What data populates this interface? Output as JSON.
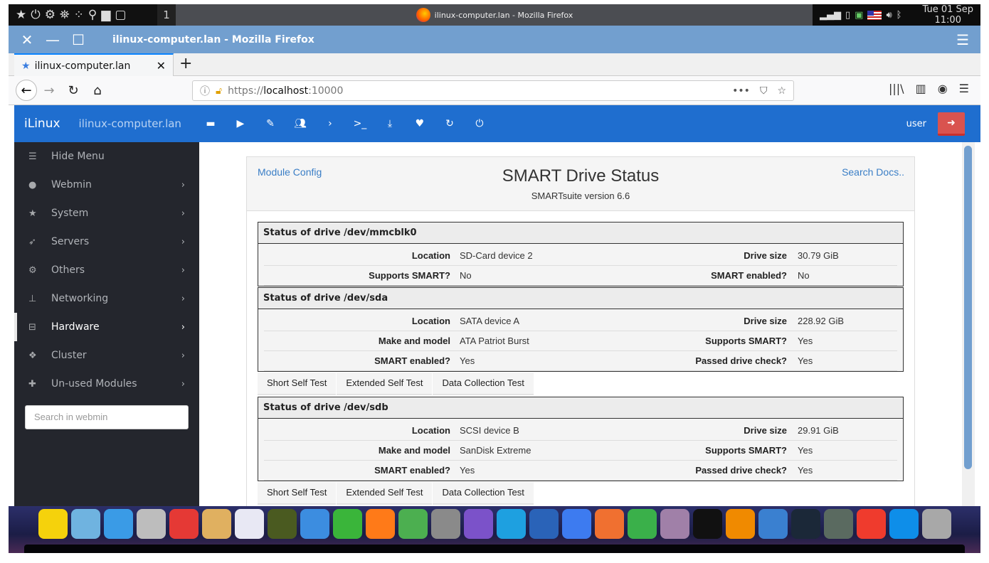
{
  "top_panel": {
    "workspace": "1",
    "window_title": "ilinux-computer.lan - Mozilla Firefox",
    "clock_day": "Tue 01 Sep",
    "clock_time": "11:00"
  },
  "window": {
    "title": "ilinux-computer.lan - Mozilla Firefox"
  },
  "browser": {
    "tab_title": "ilinux-computer.lan",
    "url_scheme": "https://",
    "url_host": "localhost",
    "url_port": ":10000"
  },
  "webmin_header": {
    "brand": "iLinux",
    "hostname": "ilinux-computer.lan",
    "user": "user",
    "icons": [
      "folder-icon",
      "play-icon",
      "pencil-icon",
      "users-icon",
      "chevron-right-icon",
      "terminal-icon",
      "download-icon",
      "heartbeat-icon",
      "refresh-icon",
      "power-icon"
    ]
  },
  "sidebar": {
    "items": [
      {
        "label": "Hide Menu",
        "icon": "bars-icon",
        "chevron": false
      },
      {
        "label": "Webmin",
        "icon": "globe-icon",
        "chevron": true
      },
      {
        "label": "System",
        "icon": "star-icon",
        "chevron": true
      },
      {
        "label": "Servers",
        "icon": "rocket-icon",
        "chevron": true
      },
      {
        "label": "Others",
        "icon": "gears-icon",
        "chevron": true
      },
      {
        "label": "Networking",
        "icon": "sitemap-icon",
        "chevron": true
      },
      {
        "label": "Hardware",
        "icon": "hdd-icon",
        "chevron": true,
        "active": true
      },
      {
        "label": "Cluster",
        "icon": "cubes-icon",
        "chevron": true
      },
      {
        "label": "Un-used Modules",
        "icon": "puzzle-icon",
        "chevron": true
      }
    ],
    "search_placeholder": "Search in webmin"
  },
  "page": {
    "module_config": "Module Config",
    "search_docs": "Search Docs..",
    "title": "SMART Drive Status",
    "subtitle": "SMARTsuite version 6.6"
  },
  "drives": [
    {
      "header": "Status of drive /dev/mmcblk0",
      "rows": [
        [
          "Location",
          "SD-Card device 2",
          "Drive size",
          "30.79 GiB"
        ],
        [
          "Supports SMART?",
          "No",
          "SMART enabled?",
          "No"
        ]
      ],
      "tests": []
    },
    {
      "header": "Status of drive /dev/sda",
      "rows": [
        [
          "Location",
          "SATA device A",
          "Drive size",
          "228.92 GiB"
        ],
        [
          "Make and model",
          "ATA Patriot Burst",
          "Supports SMART?",
          "Yes"
        ],
        [
          "SMART enabled?",
          "Yes",
          "Passed drive check?",
          "Yes"
        ]
      ],
      "tests": [
        "Short Self Test",
        "Extended Self Test",
        "Data Collection Test"
      ]
    },
    {
      "header": "Status of drive /dev/sdb",
      "rows": [
        [
          "Location",
          "SCSI device B",
          "Drive size",
          "29.91 GiB"
        ],
        [
          "Make and model",
          "SanDisk Extreme",
          "Supports SMART?",
          "Yes"
        ],
        [
          "SMART enabled?",
          "Yes",
          "Passed drive check?",
          "Yes"
        ]
      ],
      "tests": [
        "Short Self Test",
        "Extended Self Test",
        "Data Collection Test"
      ]
    }
  ],
  "dock": [
    {
      "name": "star-app",
      "color": "#f5d20c"
    },
    {
      "name": "dots-app",
      "color": "#6fb3e0"
    },
    {
      "name": "window-app",
      "color": "#3a9be6"
    },
    {
      "name": "file-cabinet",
      "color": "#bdbdbd"
    },
    {
      "name": "toggle-settings",
      "color": "#e53935"
    },
    {
      "name": "color-palette",
      "color": "#e0b060"
    },
    {
      "name": "store-bag",
      "color": "#e8e8f4"
    },
    {
      "name": "binoculars",
      "color": "#4a5a20"
    },
    {
      "name": "plane-app",
      "color": "#3c8de0"
    },
    {
      "name": "green-pipe",
      "color": "#3ab53a"
    },
    {
      "name": "firefox",
      "color": "#ff7a18"
    },
    {
      "name": "chrome",
      "color": "#4caf50"
    },
    {
      "name": "pro-app",
      "color": "#8a8a8a"
    },
    {
      "name": "viber",
      "color": "#7b52c9"
    },
    {
      "name": "skype",
      "color": "#1ea0e0"
    },
    {
      "name": "thunderbird",
      "color": "#2a63b8"
    },
    {
      "name": "wps-writer",
      "color": "#3d7bf0"
    },
    {
      "name": "wps-presentation",
      "color": "#f07030"
    },
    {
      "name": "wps-spreadsheet",
      "color": "#3ab04a"
    },
    {
      "name": "webcam-app",
      "color": "#a080a8"
    },
    {
      "name": "a-app",
      "color": "#111111"
    },
    {
      "name": "vlc",
      "color": "#f08a00"
    },
    {
      "name": "qbittorrent",
      "color": "#3a80d0"
    },
    {
      "name": "steam",
      "color": "#1b2838"
    },
    {
      "name": "restore-app",
      "color": "#5a6a60"
    },
    {
      "name": "anydesk",
      "color": "#ef3b2d"
    },
    {
      "name": "teamviewer",
      "color": "#0e8ee9"
    },
    {
      "name": "trash",
      "color": "#a8a8a8"
    }
  ]
}
